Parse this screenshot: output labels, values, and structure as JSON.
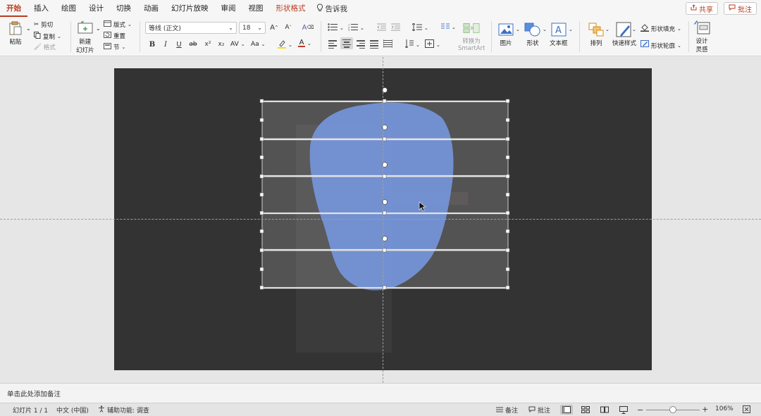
{
  "tabs": [
    {
      "label": "开始",
      "state": "active"
    },
    {
      "label": "插入",
      "state": ""
    },
    {
      "label": "绘图",
      "state": ""
    },
    {
      "label": "设计",
      "state": ""
    },
    {
      "label": "切换",
      "state": ""
    },
    {
      "label": "动画",
      "state": ""
    },
    {
      "label": "幻灯片放映",
      "state": ""
    },
    {
      "label": "审阅",
      "state": ""
    },
    {
      "label": "视图",
      "state": ""
    },
    {
      "label": "形状格式",
      "state": "context"
    }
  ],
  "tell_me": "告诉我",
  "share_label": "共享",
  "comments_label": "批注",
  "ribbon": {
    "paste": "粘贴",
    "cut": "剪切",
    "copy": "复制",
    "format": "格式",
    "new_slide_line1": "新建",
    "new_slide_line2": "幻灯片",
    "layout": "版式",
    "reset": "重置",
    "section": "节",
    "font_name": "等线 (正文)",
    "font_size": "18",
    "bold": "B",
    "italic": "I",
    "underline": "U",
    "strike": "ab",
    "superscript": "x²",
    "subscript": "x₂",
    "char_spacing": "AV",
    "change_case": "Aa",
    "smartart_line1": "转换为",
    "smartart_line2": "SmartArt",
    "picture": "图片",
    "shape": "形状",
    "textbox": "文本框",
    "arrange": "排列",
    "quick_styles": "快速样式",
    "shape_fill": "形状填充",
    "shape_outline": "形状轮廓",
    "designer_line1": "设计",
    "designer_line2": "灵感"
  },
  "notes_placeholder": "单击此处添加备注",
  "status": {
    "slide_counter": "幻灯片 1 / 1",
    "language": "中文 (中国)",
    "accessibility": "辅助功能: 调查",
    "notes": "备注",
    "comments": "批注",
    "zoom": "106%"
  },
  "colors": {
    "accent": "#b83b1e",
    "slide_bg": "#333333",
    "shape_fill": "#5b7fd1"
  }
}
